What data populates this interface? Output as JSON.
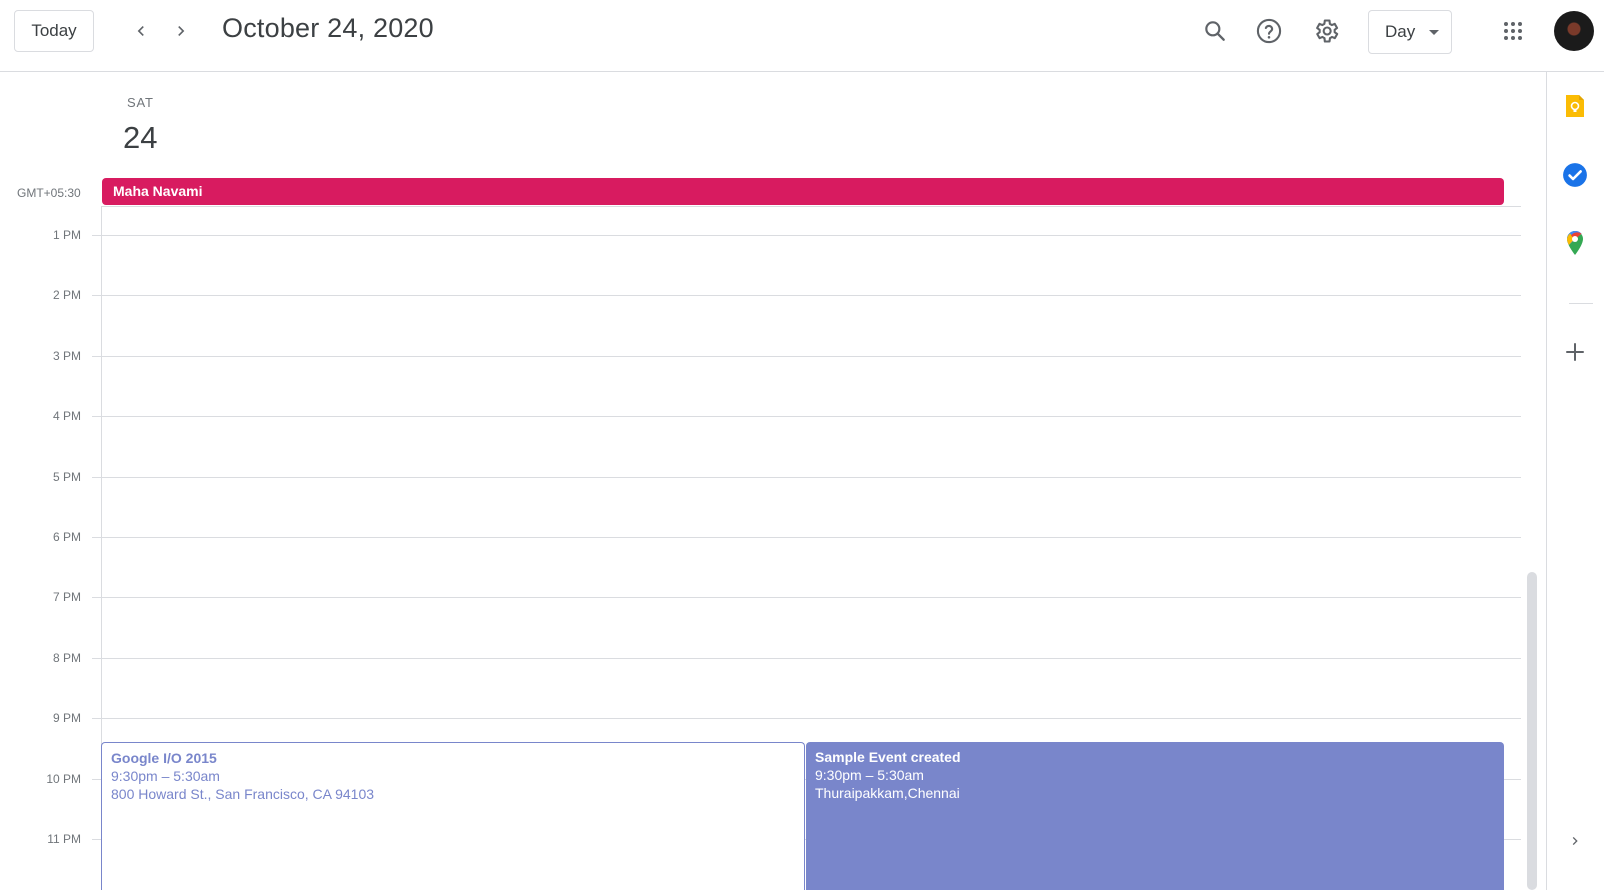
{
  "header": {
    "today_label": "Today",
    "prev_icon": "chevron-left-icon",
    "next_icon": "chevron-right-icon",
    "date_title": "October 24, 2020",
    "search_icon": "search-icon",
    "help_icon": "help-icon",
    "settings_icon": "gear-icon",
    "view_label": "Day",
    "apps_icon": "apps-grid-icon",
    "avatar_icon": "account-avatar"
  },
  "day": {
    "weekday": "SAT",
    "number": "24",
    "timezone": "GMT+05:30"
  },
  "all_day_event": {
    "title": "Maha Navami",
    "color": "#d81b60"
  },
  "hours": [
    "1 PM",
    "2 PM",
    "3 PM",
    "4 PM",
    "5 PM",
    "6 PM",
    "7 PM",
    "8 PM",
    "9 PM",
    "10 PM",
    "11 PM"
  ],
  "events": [
    {
      "title": "Google I/O 2015",
      "time": "9:30pm – 5:30am",
      "location": "800 Howard St., San Francisco, CA 94103",
      "color": "#7986cb",
      "style": "outlined"
    },
    {
      "title": "Sample Event created",
      "time": "9:30pm – 5:30am",
      "location": "Thuraipakkam,Chennai",
      "color": "#7986cb",
      "style": "filled"
    }
  ],
  "side_panel": {
    "icons": [
      "keep-icon",
      "tasks-icon",
      "maps-icon",
      "add-icon",
      "expand-icon"
    ]
  }
}
